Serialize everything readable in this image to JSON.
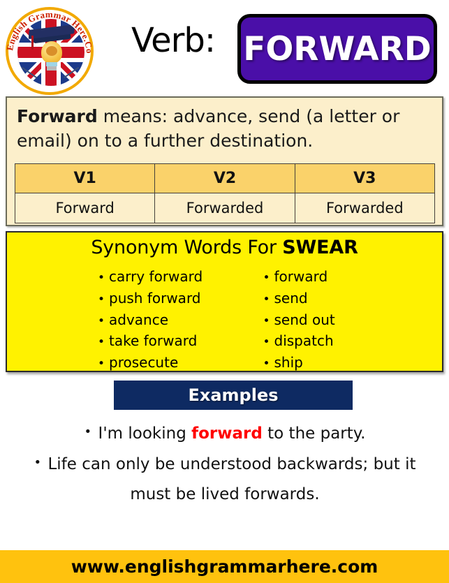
{
  "logo": {
    "alt": "English Grammar Here.Com badge",
    "text_top": "English Grammar",
    "text_bottom": "Here.Com",
    "full_text": "English Grammar Here.Com"
  },
  "header": {
    "part_of_speech_label": "Verb:",
    "word": "FORWARD",
    "badge_color": "#4a0fa8",
    "badge_text_color": "#ffffff"
  },
  "definition": {
    "term": "Forward",
    "connector": " means: ",
    "body": "advance, send (a letter or email) on to a further destination."
  },
  "verb_table": {
    "headers": [
      "V1",
      "V2",
      "V3"
    ],
    "rows": [
      [
        "Forward",
        "Forwarded",
        "Forwarded"
      ]
    ],
    "header_bg": "#FAD26A",
    "body_bg": "#FCEFCB"
  },
  "synonyms": {
    "title_prefix": "Synonym Words For ",
    "title_word": "SWEAR",
    "bullet": "•",
    "background": "#FFF200",
    "left_column": [
      "carry forward",
      "push forward",
      "advance",
      "take forward",
      "prosecute"
    ],
    "right_column": [
      "forward",
      "send",
      "send out",
      "dispatch",
      "ship"
    ]
  },
  "examples": {
    "banner_label": "Examples",
    "banner_color": "#0E2A62",
    "bullet": "•",
    "highlight_color": "#FF0000",
    "items": [
      {
        "before": "I'm looking ",
        "highlight": "forward",
        "after": " to the party."
      },
      {
        "line1": "Life can only be understood  backwards; but it",
        "line2_before": "must be lived ",
        "line2_highlight": "forwards",
        "line2_after": "."
      }
    ]
  },
  "footer": {
    "url": "www.englishgrammarhere.com",
    "background": "#FFC20E"
  }
}
